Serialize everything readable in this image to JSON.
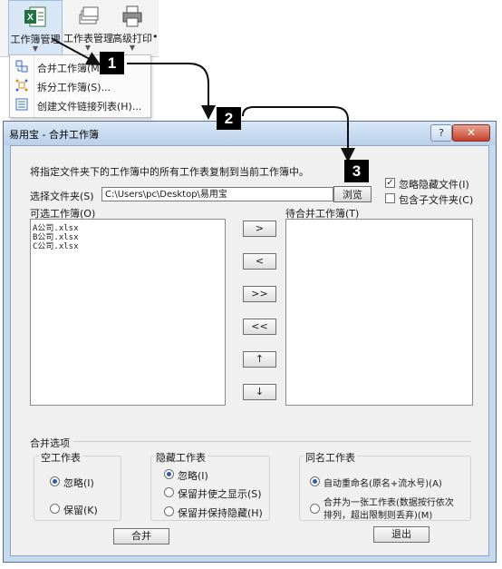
{
  "ribbon": {
    "buttons": [
      {
        "label": "工作簿管理"
      },
      {
        "label": "工作表管理"
      },
      {
        "label": "高级打印"
      }
    ],
    "more_label": "•"
  },
  "menu": {
    "items": [
      {
        "label": "合并工作簿(M)..."
      },
      {
        "label": "拆分工作簿(S)..."
      },
      {
        "label": "创建文件链接列表(H)..."
      }
    ]
  },
  "callouts": [
    "1",
    "2",
    "3"
  ],
  "dialog": {
    "title": "易用宝 - 合并工作簿",
    "help_label": "?",
    "close_label": "✕",
    "description": "将指定文件夹下的工作簿中的所有工作表复制到当前工作簿中。",
    "folder_label": "选择文件夹(S)",
    "folder_value": "C:\\Users\\pc\\Desktop\\易用宝",
    "browse_label": "浏览",
    "ignore_hidden_files_label": "忽略隐藏文件(I)",
    "include_subfolders_label": "包含子文件夹(C)",
    "available_label": "可选工作簿(O)",
    "available_items": [
      "A公司.xlsx",
      "B公司.xlsx",
      "C公司.xlsx"
    ],
    "pending_label": "待合并工作簿(T)",
    "move_buttons": [
      ">",
      "<",
      ">>",
      "<<",
      "↑",
      "↓"
    ],
    "merge_options_label": "合并选项",
    "empty_sheet": {
      "label": "空工作表",
      "options": [
        "忽略(I)",
        "保留(K)"
      ],
      "selected": 0
    },
    "hidden_sheet": {
      "label": "隐藏工作表",
      "options": [
        "忽略(I)",
        "保留并使之显示(S)",
        "保留并保持隐藏(H)"
      ],
      "selected": 0
    },
    "same_name_sheet": {
      "label": "同名工作表",
      "options": [
        "自动重命名(原名+流水号)(A)",
        "合并为一张工作表(数据按行依次",
        "排列，超出限制则丢弃)(M)"
      ],
      "selected": 0
    },
    "merge_button": "合并",
    "exit_button": "退出"
  }
}
